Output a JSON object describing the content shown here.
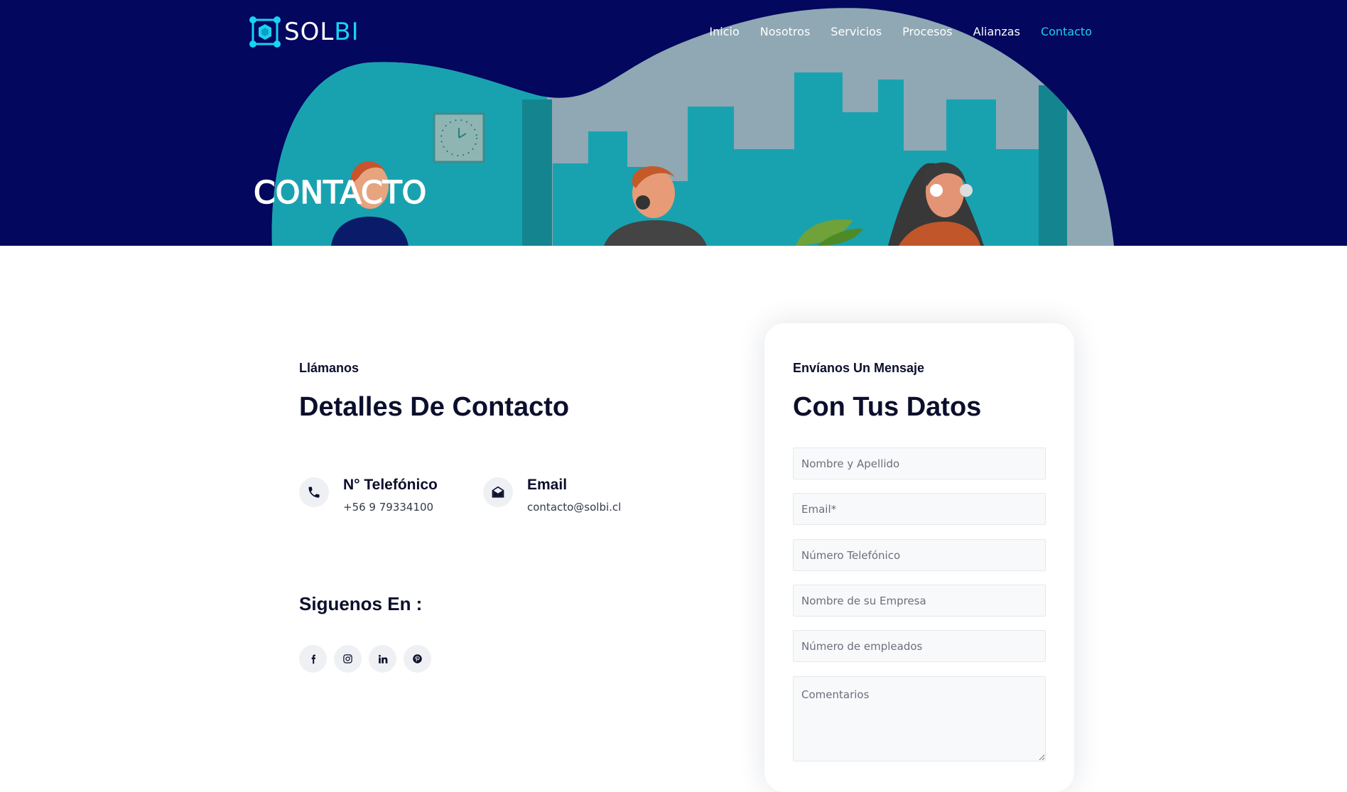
{
  "header": {
    "logo": {
      "part1": "SOL",
      "part2": "BI"
    },
    "nav": [
      {
        "label": "Inicio",
        "active": false
      },
      {
        "label": "Nosotros",
        "active": false
      },
      {
        "label": "Servicios",
        "active": false
      },
      {
        "label": "Procesos",
        "active": false
      },
      {
        "label": "Alianzas",
        "active": false
      },
      {
        "label": "Contacto",
        "active": true
      }
    ]
  },
  "hero": {
    "title": "CONTACTO"
  },
  "contact": {
    "eyebrow": "Llámanos",
    "title": "Detalles De Contacto",
    "phone": {
      "icon": "phone-icon",
      "label": "N° Telefónico",
      "value": "+56 9 79334100"
    },
    "email": {
      "icon": "envelope-open-icon",
      "label": "Email",
      "value": "contacto@solbi.cl"
    },
    "follow_title": "Siguenos En :",
    "socials": [
      "facebook-icon",
      "instagram-icon",
      "linkedin-icon",
      "pinterest-icon"
    ]
  },
  "form": {
    "eyebrow": "Envíanos Un Mensaje",
    "title": "Con Tus Datos",
    "fields": {
      "name": {
        "placeholder": "Nombre y Apellido",
        "value": ""
      },
      "email": {
        "placeholder": "Email*",
        "value": ""
      },
      "phone": {
        "placeholder": "Número Telefónico",
        "value": ""
      },
      "company": {
        "placeholder": "Nombre de su Empresa",
        "value": ""
      },
      "employees": {
        "placeholder": "Número de empleados",
        "value": ""
      },
      "comments": {
        "placeholder": "Comentarios",
        "value": ""
      }
    }
  },
  "colors": {
    "navy": "#03075e",
    "accent": "#1fd0ee",
    "teal": "#18a2b0",
    "text_dark": "#0b0f2c"
  }
}
